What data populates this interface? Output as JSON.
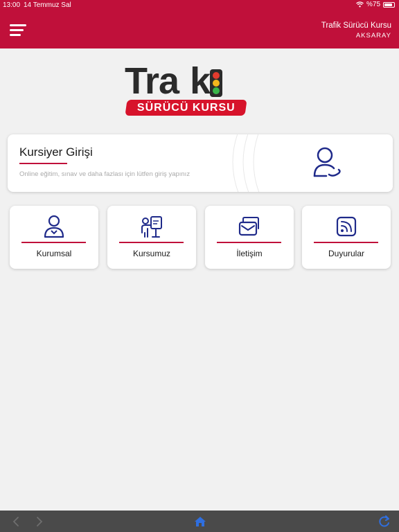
{
  "status_bar": {
    "time": "13:00",
    "date": "14 Temmuz Sal",
    "battery": "%75"
  },
  "header": {
    "title": "Trafik Sürücü Kursu",
    "city": "AKSARAY",
    "menu_icon": "hamburger-menu-icon"
  },
  "logo": {
    "word_left": "Tra",
    "word_right": "k",
    "band": "SÜRÜCÜ KURSU"
  },
  "login": {
    "title": "Kursiyer Girişi",
    "subtitle": "Online eğitim, sınav ve daha fazlası için lütfen giriş yapınız",
    "icon": "user-login-icon"
  },
  "tiles": [
    {
      "label": "Kurumsal",
      "icon": "person-badge-icon"
    },
    {
      "label": "Kursumuz",
      "icon": "classroom-icon"
    },
    {
      "label": "İletişim",
      "icon": "mail-icon"
    },
    {
      "label": "Duyurular",
      "icon": "rss-feed-icon"
    }
  ],
  "toolbar": {
    "back_icon": "chevron-left-icon",
    "forward_icon": "chevron-right-icon",
    "home_icon": "home-icon",
    "reload_icon": "reload-icon"
  },
  "colors": {
    "brand": "#c0103a",
    "accent_blue": "#1f2a8a",
    "toolbar": "#4a4a4a",
    "home_blue": "#2f6fe0"
  }
}
